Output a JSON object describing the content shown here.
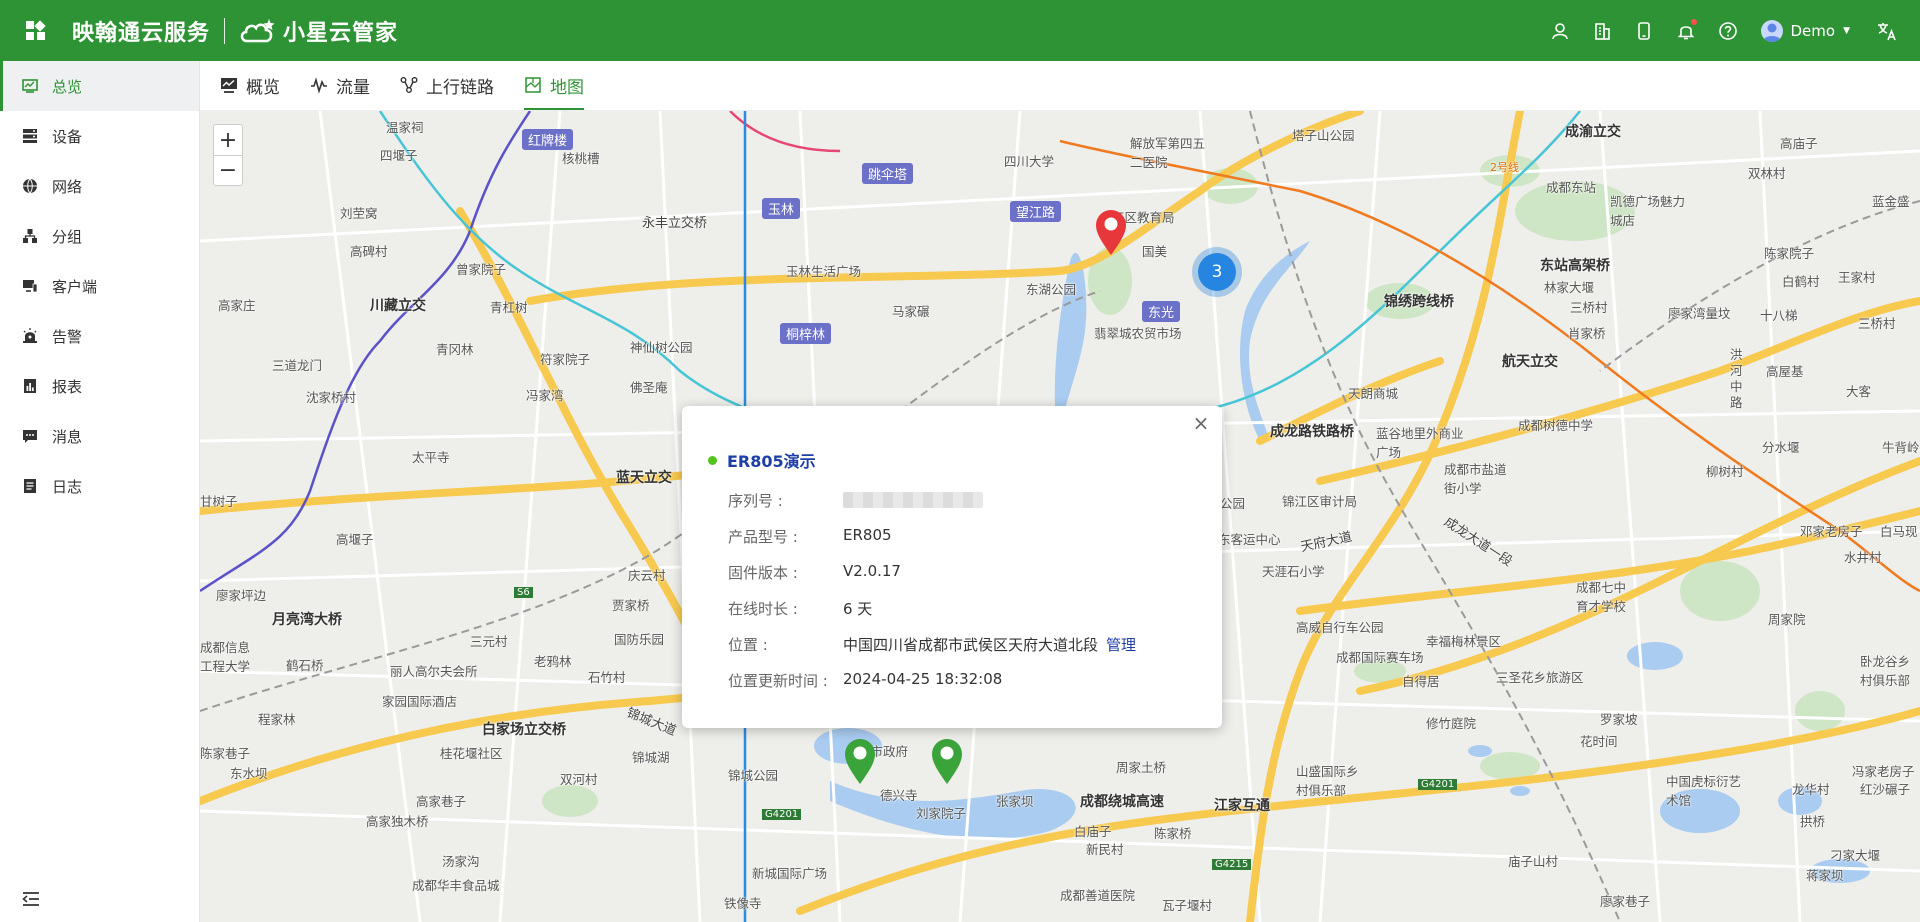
{
  "header": {
    "brand_name": "映翰通云服务",
    "product_name": "小星云管家",
    "user_name": "Demo"
  },
  "sidebar": {
    "items": [
      {
        "label": "总览",
        "icon": "dashboard-icon",
        "active": true
      },
      {
        "label": "设备",
        "icon": "device-icon"
      },
      {
        "label": "网络",
        "icon": "globe-icon"
      },
      {
        "label": "分组",
        "icon": "group-icon"
      },
      {
        "label": "客户端",
        "icon": "client-icon"
      },
      {
        "label": "告警",
        "icon": "alarm-icon"
      },
      {
        "label": "报表",
        "icon": "report-icon"
      },
      {
        "label": "消息",
        "icon": "message-icon"
      },
      {
        "label": "日志",
        "icon": "log-icon"
      }
    ]
  },
  "tabs": [
    {
      "label": "概览",
      "icon": "overview-icon"
    },
    {
      "label": "流量",
      "icon": "traffic-icon"
    },
    {
      "label": "上行链路",
      "icon": "uplink-icon"
    },
    {
      "label": "地图",
      "icon": "map-icon",
      "active": true
    }
  ],
  "map": {
    "zoom_in": "+",
    "zoom_out": "−",
    "cluster_count": "3",
    "labels": {
      "l01": "温家祠",
      "l02": "红牌楼",
      "l03": "四堰子",
      "l04": "核桃槽",
      "l05": "跳伞塔",
      "l06": "四川大学",
      "l07": "解放军第四五二医院",
      "l08": "塔子山公园",
      "l09": "成渝立交",
      "l10": "高庙子",
      "l11": "双林村",
      "l12": "刘茔窝",
      "l13": "玉林",
      "l14": "望江路",
      "l15": "江区教育局",
      "l16": "成都东站",
      "l17": "凯德广场魅力城店",
      "l18": "蓝金盛",
      "l19": "永丰立交桥",
      "l20": "国美",
      "l21": "高碑村",
      "l22": "曾家院子",
      "l23": "玉林生活广场",
      "l24": "东湖公园",
      "l25": "东站高架桥",
      "l26": "林家大堰",
      "l27": "陈家院子",
      "l28": "白鹤村",
      "l29": "王家村",
      "l30": "高家庄",
      "l31": "川藏立交",
      "l32": "青杠树",
      "l33": "马家碾",
      "l34": "三桥村",
      "l35": "廖家湾量坟",
      "l36": "十八梯",
      "l37": "三桥村",
      "l38": "锦绣跨线桥",
      "l39": "桐梓林",
      "l40": "东光",
      "l41": "翡翠城农贸市场",
      "l42": "肖家桥",
      "l43": "青冈林",
      "l44": "神仙树公园",
      "l45": "三道龙门",
      "l46": "符家院子",
      "l47": "航天立交",
      "l48": "沈家桥村",
      "l49": "佛圣庵",
      "l50": "冯家湾",
      "l51": "天朗商城",
      "l52": "高屋基",
      "l53": "大客",
      "l54": "成龙路铁路桥",
      "l55": "成都树德中学",
      "l56": "太平寺",
      "l57": "蓝谷地里外商业广场",
      "l58": "分水堰",
      "l59": "牛背岭",
      "l60": "蓝天立交",
      "l61": "柳树村",
      "l62": "成都市盐道街小学",
      "l63": "甘树子",
      "l64": "公园",
      "l65": "锦江区审计局",
      "l66": "邓家老房子",
      "l67": "白马现",
      "l68": "高堰子",
      "l69": "东客运中心",
      "l70": "成龙大道一段",
      "l71": "天涯石小学",
      "l72": "庆云村",
      "l73": "水井村",
      "l74": "廖家坪边",
      "l75": "贾家桥",
      "l76": "成都七中育才学校",
      "l77": "月亮湾大桥",
      "l78": "国防乐园",
      "l79": "高威自行车公园",
      "l80": "鹤石桥",
      "l81": "三元村",
      "l82": "周家院",
      "l83": "石竹村",
      "l84": "幸福梅林景区",
      "l85": "卧龙谷乡村俱乐部",
      "l86": "成都信息工程大学",
      "l87": "丽人高尔夫会所",
      "l88": "老鸦林",
      "l89": "成都国际赛车场",
      "l90": "自得居",
      "l91": "三圣花乡旅游区",
      "l92": "家园国际酒店",
      "l93": "程家林",
      "l94": "锦城大道",
      "l95": "修竹庭院",
      "l96": "罗家坡",
      "l97": "白家场立交桥",
      "l98": "桂花堰社区",
      "l99": "锦城湖",
      "l100": "都市政府",
      "l101": "周家土桥",
      "l102": "花时间",
      "l103": "冯家老房子",
      "l104": "陈家巷子",
      "l105": "东水坝",
      "l106": "双河村",
      "l107": "锦城公园",
      "l108": "德兴寺",
      "l109": "山盛国际乡村俱乐部",
      "l110": "中国虎标衍艺术馆",
      "l111": "龙华村",
      "l112": "红沙碾子",
      "l113": "高家巷子",
      "l114": "刘家院子",
      "l115": "张家坝",
      "l116": "成都绕城高速",
      "l117": "江家互通",
      "l118": "高家独木桥",
      "l119": "白庙子",
      "l120": "新民村",
      "l121": "陈家桥",
      "l122": "拱桥",
      "l123": "庙子山村",
      "l124": "刁家大堰",
      "l125": "汤家沟",
      "l126": "新城国际广场",
      "l127": "蒋家坝",
      "l128": "成都华丰食品城",
      "l129": "成都善道医院",
      "l130": "瓦子堰村",
      "l131": "廖家巷子",
      "l132": "铁像寺",
      "l133": "洪河中路",
      "l134": "天府大道",
      "l135": "2号线",
      "s56": "S6",
      "g4201a": "G4201",
      "g4201b": "G4201",
      "g4215": "G4215"
    }
  },
  "popup": {
    "close": "×",
    "device_name": "ER805演示",
    "rows": {
      "serial": {
        "label": "序列号 :",
        "value": ""
      },
      "model": {
        "label": "产品型号 :",
        "value": "ER805"
      },
      "firmware": {
        "label": "固件版本 :",
        "value": "V2.0.17"
      },
      "uptime": {
        "label": "在线时长 :",
        "value": "6 天"
      },
      "location": {
        "label": "位置 :",
        "value": "中国四川省成都市武侯区天府大道北段",
        "link": "管理"
      },
      "updated": {
        "label": "位置更新时间 :",
        "value": "2024-04-25 18:32:08"
      }
    }
  },
  "colors": {
    "brand": "#2e9335",
    "link": "#1f3fa8",
    "online": "#52c41a",
    "pin_red": "#e8373a",
    "pin_green": "#3aa33a",
    "cluster": "#2685e0"
  }
}
